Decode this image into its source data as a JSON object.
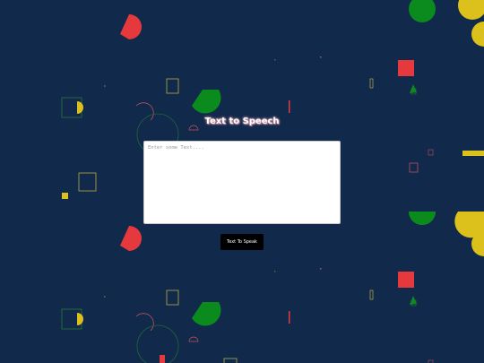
{
  "app": {
    "title": "Text to Speech"
  },
  "input": {
    "value": "",
    "placeholder": "Enter some Text...."
  },
  "speak_button": {
    "label": "Text To Speak"
  },
  "colors": {
    "background": "#11294a",
    "red": "#e6393e",
    "yellow": "#dcc01c",
    "green": "#0b8a1e",
    "button": "#000000"
  }
}
